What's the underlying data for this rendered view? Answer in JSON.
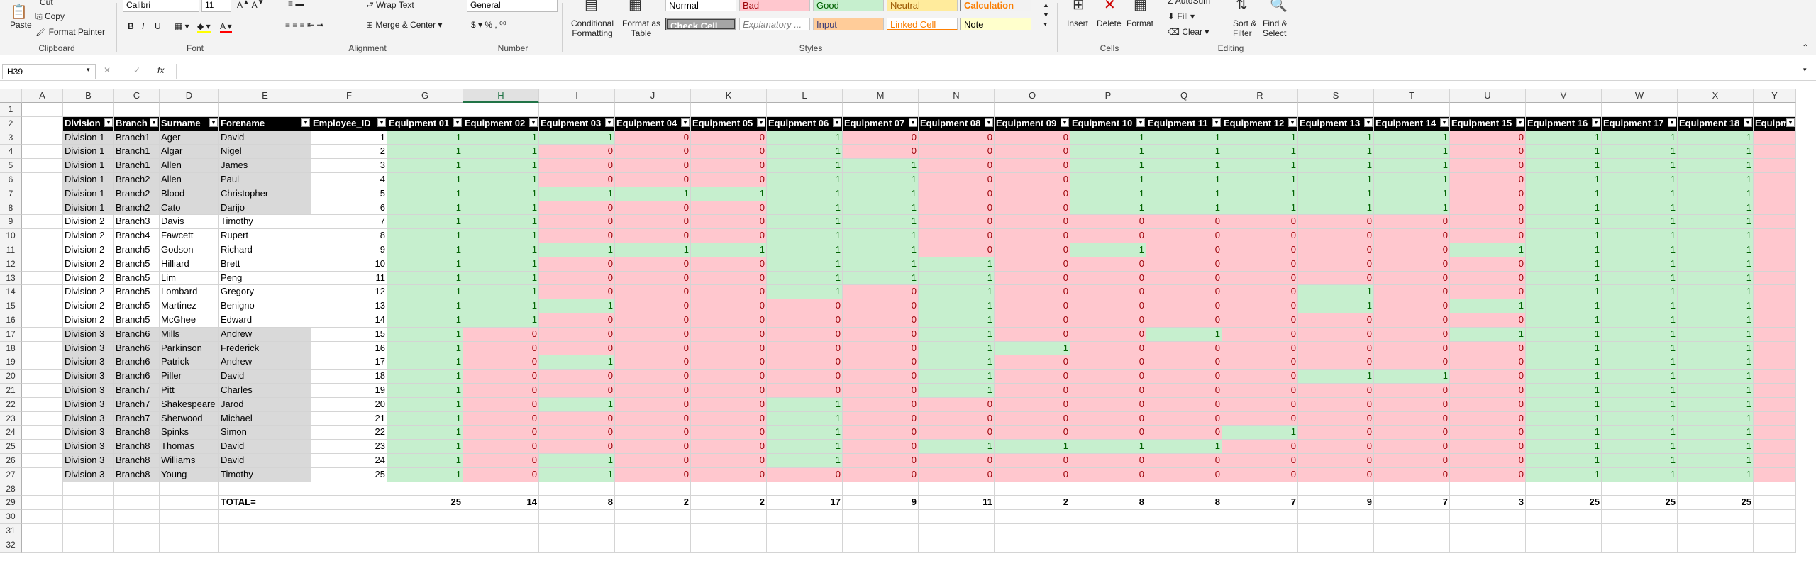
{
  "ribbon": {
    "clipboard": {
      "paste": "Paste",
      "cut": "Cut",
      "copy": "Copy",
      "format_painter": "Format Painter",
      "label": "Clipboard"
    },
    "font": {
      "name": "Calibri",
      "size": "11",
      "label": "Font",
      "bold": "B",
      "italic": "I",
      "underline": "U"
    },
    "alignment": {
      "wrap": "Wrap Text",
      "merge": "Merge & Center",
      "label": "Alignment"
    },
    "number": {
      "format": "General",
      "label": "Number"
    },
    "styles": {
      "conditional": "Conditional Formatting",
      "format_table": "Format as Table",
      "boxes": [
        "Normal",
        "Bad",
        "Good",
        "Neutral",
        "Calculation",
        "Check Cell",
        "Explanatory ...",
        "Input",
        "Linked Cell",
        "Note"
      ],
      "label": "Styles"
    },
    "cells": {
      "insert": "Insert",
      "delete": "Delete",
      "format": "Format",
      "label": "Cells"
    },
    "editing": {
      "autosum": "AutoSum",
      "fill": "Fill",
      "clear": "Clear",
      "sort": "Sort & Filter",
      "find": "Find & Select",
      "label": "Editing"
    }
  },
  "formula_bar": {
    "name_box": "H39",
    "fx": "fx",
    "formula": ""
  },
  "columns": [
    "A",
    "B",
    "C",
    "D",
    "E",
    "F",
    "G",
    "H",
    "I",
    "J",
    "K",
    "L",
    "M",
    "N",
    "O",
    "P",
    "Q",
    "R",
    "S",
    "T",
    "U",
    "V",
    "W",
    "X",
    "Y"
  ],
  "row_numbers": [
    1,
    2,
    3,
    4,
    5,
    6,
    7,
    8,
    9,
    10,
    11,
    12,
    13,
    14,
    15,
    16,
    17,
    18,
    19,
    20,
    21,
    22,
    23,
    24,
    25,
    26,
    27,
    28,
    29,
    30,
    31,
    32
  ],
  "headers": [
    "Division",
    "Branch",
    "Surname",
    "Forename",
    "Employee_ID",
    "Equipment 01",
    "Equipment 02",
    "Equipment 03",
    "Equipment 04",
    "Equipment 05",
    "Equipment 06",
    "Equipment 07",
    "Equipment 08",
    "Equipment 09",
    "Equipment 10",
    "Equipment 11",
    "Equipment 12",
    "Equipment 13",
    "Equipment 14",
    "Equipment 15",
    "Equipment 16",
    "Equipment 17",
    "Equipment 18",
    "Equipme"
  ],
  "rows": [
    {
      "division": "Division 1",
      "branch": "Branch1",
      "surname": "Ager",
      "forename": "David",
      "id": 1,
      "eq": [
        1,
        1,
        1,
        0,
        0,
        1,
        0,
        0,
        0,
        1,
        1,
        1,
        1,
        1,
        0,
        1,
        1,
        1,
        0
      ]
    },
    {
      "division": "Division 1",
      "branch": "Branch1",
      "surname": "Algar",
      "forename": "Nigel",
      "id": 2,
      "eq": [
        1,
        1,
        0,
        0,
        0,
        1,
        0,
        0,
        0,
        1,
        1,
        1,
        1,
        1,
        0,
        1,
        1,
        1,
        0
      ]
    },
    {
      "division": "Division 1",
      "branch": "Branch1",
      "surname": "Allen",
      "forename": "James",
      "id": 3,
      "eq": [
        1,
        1,
        0,
        0,
        0,
        1,
        1,
        0,
        0,
        1,
        1,
        1,
        1,
        1,
        0,
        1,
        1,
        1,
        0
      ]
    },
    {
      "division": "Division 1",
      "branch": "Branch2",
      "surname": "Allen",
      "forename": "Paul",
      "id": 4,
      "eq": [
        1,
        1,
        0,
        0,
        0,
        1,
        1,
        0,
        0,
        1,
        1,
        1,
        1,
        1,
        0,
        1,
        1,
        1,
        0
      ]
    },
    {
      "division": "Division 1",
      "branch": "Branch2",
      "surname": "Blood",
      "forename": "Christopher",
      "id": 5,
      "eq": [
        1,
        1,
        1,
        1,
        1,
        1,
        1,
        0,
        0,
        1,
        1,
        1,
        1,
        1,
        0,
        1,
        1,
        1,
        0
      ]
    },
    {
      "division": "Division 1",
      "branch": "Branch2",
      "surname": "Cato",
      "forename": "Darijo",
      "id": 6,
      "eq": [
        1,
        1,
        0,
        0,
        0,
        1,
        1,
        0,
        0,
        1,
        1,
        1,
        1,
        1,
        0,
        1,
        1,
        1,
        0
      ]
    },
    {
      "division": "Division 2",
      "branch": "Branch3",
      "surname": "Davis",
      "forename": "Timothy",
      "id": 7,
      "eq": [
        1,
        1,
        0,
        0,
        0,
        1,
        1,
        0,
        0,
        0,
        0,
        0,
        0,
        0,
        0,
        1,
        1,
        1,
        0
      ]
    },
    {
      "division": "Division 2",
      "branch": "Branch4",
      "surname": "Fawcett",
      "forename": "Rupert",
      "id": 8,
      "eq": [
        1,
        1,
        0,
        0,
        0,
        1,
        1,
        0,
        0,
        0,
        0,
        0,
        0,
        0,
        0,
        1,
        1,
        1,
        0
      ]
    },
    {
      "division": "Division 2",
      "branch": "Branch5",
      "surname": "Godson",
      "forename": "Richard",
      "id": 9,
      "eq": [
        1,
        1,
        1,
        1,
        1,
        1,
        1,
        0,
        0,
        1,
        0,
        0,
        0,
        0,
        1,
        1,
        1,
        1,
        0
      ]
    },
    {
      "division": "Division 2",
      "branch": "Branch5",
      "surname": "Hilliard",
      "forename": "Brett",
      "id": 10,
      "eq": [
        1,
        1,
        0,
        0,
        0,
        1,
        1,
        1,
        0,
        0,
        0,
        0,
        0,
        0,
        0,
        1,
        1,
        1,
        0
      ]
    },
    {
      "division": "Division 2",
      "branch": "Branch5",
      "surname": "Lim",
      "forename": "Peng",
      "id": 11,
      "eq": [
        1,
        1,
        0,
        0,
        0,
        1,
        1,
        1,
        0,
        0,
        0,
        0,
        0,
        0,
        0,
        1,
        1,
        1,
        0
      ]
    },
    {
      "division": "Division 2",
      "branch": "Branch5",
      "surname": "Lombard",
      "forename": "Gregory",
      "id": 12,
      "eq": [
        1,
        1,
        0,
        0,
        0,
        1,
        0,
        1,
        0,
        0,
        0,
        0,
        1,
        0,
        0,
        1,
        1,
        1,
        0
      ]
    },
    {
      "division": "Division 2",
      "branch": "Branch5",
      "surname": "Martinez",
      "forename": "Benigno",
      "id": 13,
      "eq": [
        1,
        1,
        1,
        0,
        0,
        0,
        0,
        1,
        0,
        0,
        0,
        0,
        1,
        0,
        1,
        1,
        1,
        1,
        0
      ]
    },
    {
      "division": "Division 2",
      "branch": "Branch5",
      "surname": "McGhee",
      "forename": "Edward",
      "id": 14,
      "eq": [
        1,
        1,
        0,
        0,
        0,
        0,
        0,
        1,
        0,
        0,
        0,
        0,
        0,
        0,
        0,
        1,
        1,
        1,
        0
      ]
    },
    {
      "division": "Division 3",
      "branch": "Branch6",
      "surname": "Mills",
      "forename": "Andrew",
      "id": 15,
      "eq": [
        1,
        0,
        0,
        0,
        0,
        0,
        0,
        1,
        0,
        0,
        1,
        0,
        0,
        0,
        1,
        1,
        1,
        1,
        0
      ]
    },
    {
      "division": "Division 3",
      "branch": "Branch6",
      "surname": "Parkinson",
      "forename": "Frederick",
      "id": 16,
      "eq": [
        1,
        0,
        0,
        0,
        0,
        0,
        0,
        1,
        1,
        0,
        0,
        0,
        0,
        0,
        0,
        1,
        1,
        1,
        0
      ]
    },
    {
      "division": "Division 3",
      "branch": "Branch6",
      "surname": "Patrick",
      "forename": "Andrew",
      "id": 17,
      "eq": [
        1,
        0,
        1,
        0,
        0,
        0,
        0,
        1,
        0,
        0,
        0,
        0,
        0,
        0,
        0,
        1,
        1,
        1,
        0
      ]
    },
    {
      "division": "Division 3",
      "branch": "Branch6",
      "surname": "Piller",
      "forename": "David",
      "id": 18,
      "eq": [
        1,
        0,
        0,
        0,
        0,
        0,
        0,
        1,
        0,
        0,
        0,
        0,
        1,
        1,
        0,
        1,
        1,
        1,
        0
      ]
    },
    {
      "division": "Division 3",
      "branch": "Branch7",
      "surname": "Pitt",
      "forename": "Charles",
      "id": 19,
      "eq": [
        1,
        0,
        0,
        0,
        0,
        0,
        0,
        1,
        0,
        0,
        0,
        0,
        0,
        0,
        0,
        1,
        1,
        1,
        0
      ]
    },
    {
      "division": "Division 3",
      "branch": "Branch7",
      "surname": "Shakespeare",
      "forename": "Jarod",
      "id": 20,
      "eq": [
        1,
        0,
        1,
        0,
        0,
        1,
        0,
        0,
        0,
        0,
        0,
        0,
        0,
        0,
        0,
        1,
        1,
        1,
        0
      ]
    },
    {
      "division": "Division 3",
      "branch": "Branch7",
      "surname": "Sherwood",
      "forename": "Michael",
      "id": 21,
      "eq": [
        1,
        0,
        0,
        0,
        0,
        1,
        0,
        0,
        0,
        0,
        0,
        0,
        0,
        0,
        0,
        1,
        1,
        1,
        0
      ]
    },
    {
      "division": "Division 3",
      "branch": "Branch8",
      "surname": "Spinks",
      "forename": "Simon",
      "id": 22,
      "eq": [
        1,
        0,
        0,
        0,
        0,
        1,
        0,
        0,
        0,
        0,
        0,
        1,
        0,
        0,
        0,
        1,
        1,
        1,
        0
      ]
    },
    {
      "division": "Division 3",
      "branch": "Branch8",
      "surname": "Thomas",
      "forename": "David",
      "id": 23,
      "eq": [
        1,
        0,
        0,
        0,
        0,
        1,
        0,
        1,
        1,
        1,
        1,
        0,
        0,
        0,
        0,
        1,
        1,
        1,
        0
      ]
    },
    {
      "division": "Division 3",
      "branch": "Branch8",
      "surname": "Williams",
      "forename": "David",
      "id": 24,
      "eq": [
        1,
        0,
        1,
        0,
        0,
        1,
        0,
        0,
        0,
        0,
        0,
        0,
        0,
        0,
        0,
        1,
        1,
        1,
        0
      ]
    },
    {
      "division": "Division 3",
      "branch": "Branch8",
      "surname": "Young",
      "forename": "Timothy",
      "id": 25,
      "eq": [
        1,
        0,
        1,
        0,
        0,
        0,
        0,
        0,
        0,
        0,
        0,
        0,
        0,
        0,
        0,
        1,
        1,
        1,
        0
      ]
    }
  ],
  "total_label": "TOTAL=",
  "totals": [
    25,
    14,
    8,
    2,
    2,
    17,
    9,
    11,
    2,
    8,
    8,
    7,
    9,
    7,
    3,
    25,
    25,
    25
  ],
  "colors": {
    "green_fill": "#c6efce",
    "green_text": "#006100",
    "red_fill": "#ffc7ce",
    "red_text": "#9c0006",
    "header": "#000000",
    "accent": "#217346"
  }
}
